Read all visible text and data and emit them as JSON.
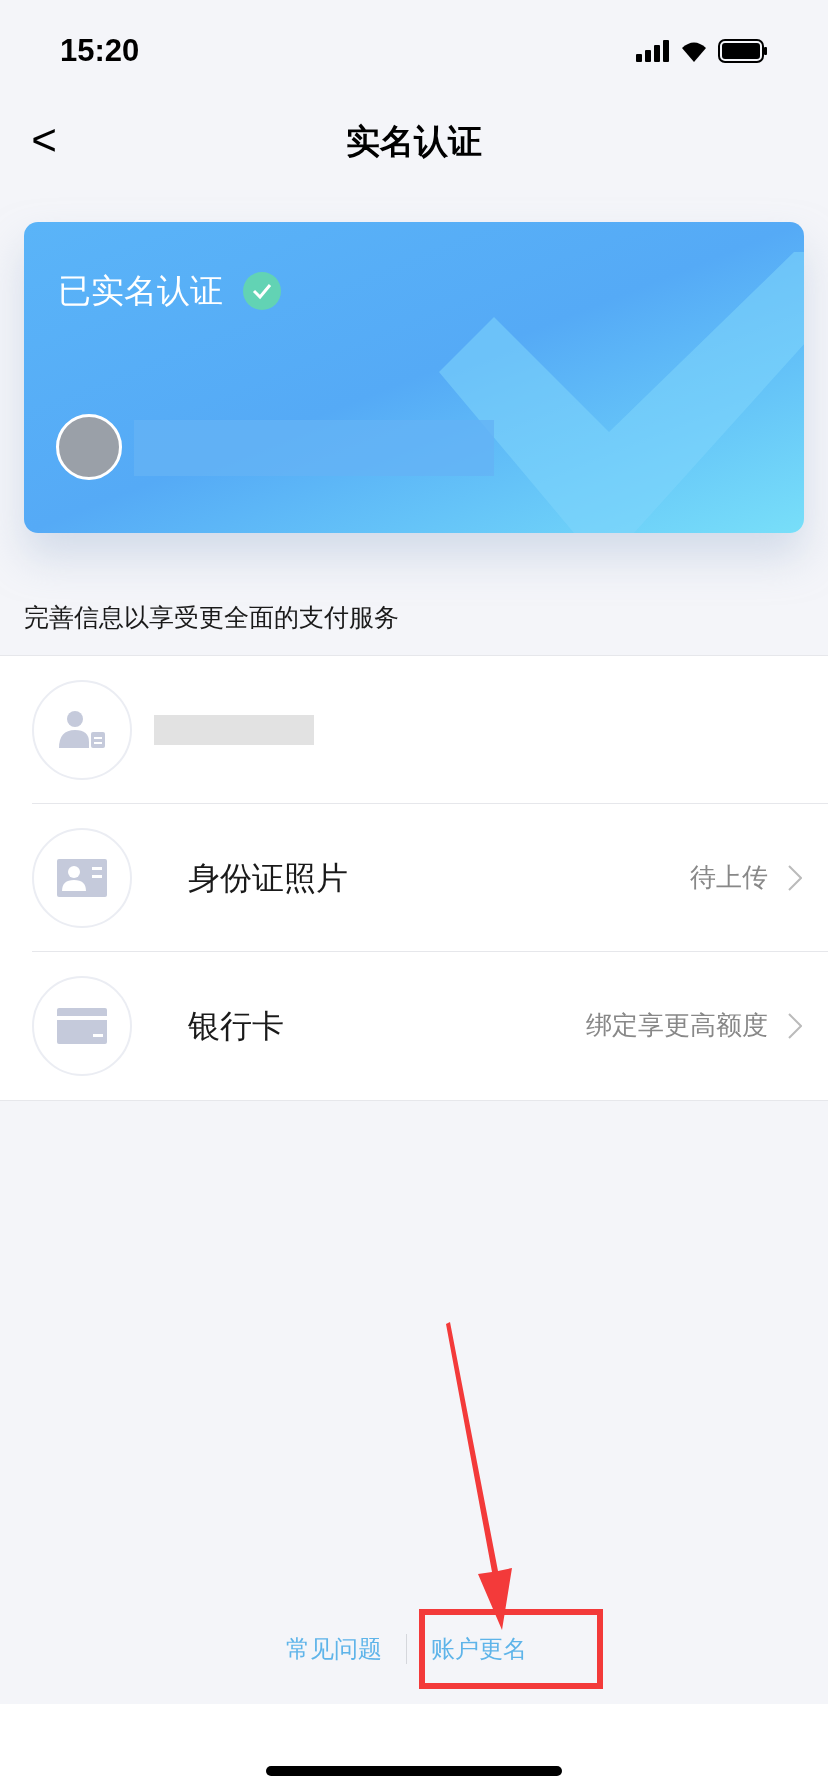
{
  "status_bar": {
    "time": "15:20"
  },
  "nav": {
    "back": "<",
    "title": "实名认证"
  },
  "card": {
    "status": "已实名认证",
    "verified": true
  },
  "section_hint": "完善信息以享受更全面的支付服务",
  "rows": [
    {
      "kind": "person",
      "redacted": true
    },
    {
      "kind": "idcard",
      "title": "身份证照片",
      "value": "待上传",
      "redacted": false
    },
    {
      "kind": "bankcard",
      "title": "银行卡",
      "value": "绑定享更高额度",
      "redacted": false
    }
  ],
  "footer_links": [
    {
      "label": "常见问题",
      "highlighted": false
    },
    {
      "label": "账户更名",
      "highlighted": true
    }
  ]
}
